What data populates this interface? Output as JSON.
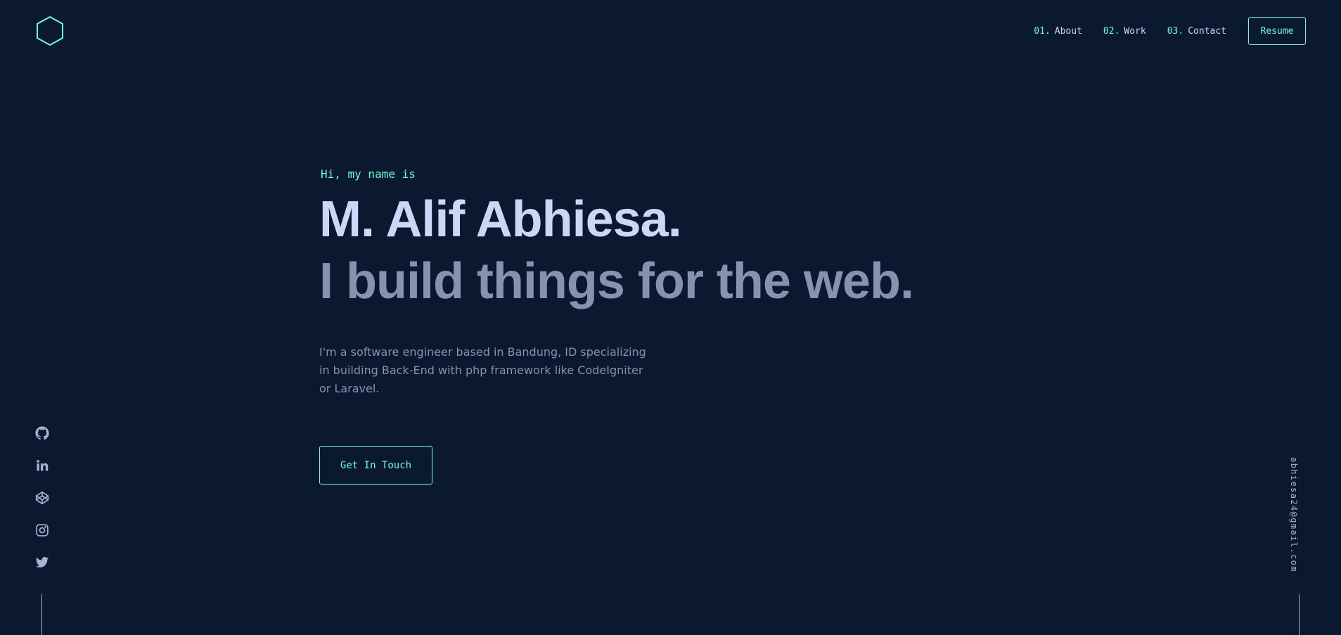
{
  "header": {
    "logo_icon": "hexagon-logo-icon",
    "nav": [
      {
        "number": "01.",
        "label": "About"
      },
      {
        "number": "02.",
        "label": "Work"
      },
      {
        "number": "03.",
        "label": "Contact"
      }
    ],
    "resume_label": "Resume"
  },
  "hero": {
    "intro": "Hi, my name is",
    "name": "M. Alif Abhiesa.",
    "tagline": "I build things for the web.",
    "description": "I'm a software engineer based in Bandung, ID specializing in building Back-End with php framework like CodeIgniter or Laravel.",
    "cta_label": "Get In Touch"
  },
  "social": [
    {
      "icon": "github-icon"
    },
    {
      "icon": "linkedin-icon"
    },
    {
      "icon": "codepen-icon"
    },
    {
      "icon": "instagram-icon"
    },
    {
      "icon": "twitter-icon"
    }
  ],
  "email": "abhiesa24@gmail.com",
  "colors": {
    "background": "#0a192f",
    "accent": "#64ffda",
    "heading": "#ccd6f6",
    "text": "#8892b0"
  }
}
